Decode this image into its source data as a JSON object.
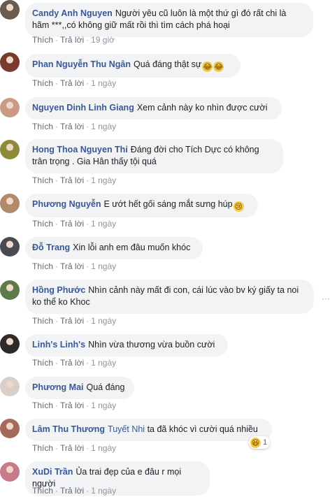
{
  "labels": {
    "like": "Thích",
    "reply": "Trả lời",
    "separator": "·"
  },
  "comments": [
    {
      "author": "Candy Anh Nguyen",
      "text": "Người yêu cũ luôn là một thứ gì đó rất chi là hãm ***,,có không giữ mất rồi thì tìm cách phá hoại",
      "time": "19 giờ"
    },
    {
      "author": "Phan Nguyễn Thu Ngân",
      "text": "Quá đáng thật sự",
      "emoji": [
        "😂",
        "😂"
      ],
      "time": "1 ngày"
    },
    {
      "author": "Nguyen Dinh Linh Giang",
      "text": "Xem cảnh này ko nhìn được cười",
      "time": "1 ngày"
    },
    {
      "author": "Hong Thoa Nguyen Thi",
      "text": "Đáng đời cho Tích Dực có không trân trọng . Gia Hân thấy tội quá",
      "time": "1 ngày"
    },
    {
      "author": "Phương Nguyễn",
      "text": "E ướt hết gối sáng mắt sưng húp",
      "emoji": [
        "😢"
      ],
      "time": "1 ngày"
    },
    {
      "author": "Đỗ Trang",
      "text": "Xin lỗi anh em đâu muốn khóc",
      "time": "1 ngày"
    },
    {
      "author": "Hồng Phước",
      "text": "Nhìn cảnh này mất đi con, cái lúc vào bv ký giấy ta noi ko thể ko Khoc",
      "time": "1 ngày"
    },
    {
      "author": "Linh's Linh's",
      "text": "Nhìn vừa thương vừa buồn cười",
      "time": "1 ngày"
    },
    {
      "author": "Phương Mai",
      "text": "Quá đáng",
      "time": "1 ngày"
    },
    {
      "author": "Lâm Thu Thương",
      "mention": "Tuyết Nhi",
      "text": "ta đã khóc vì cười quá nhiều",
      "reaction": {
        "emoji": "😆",
        "count": "1"
      },
      "time": "1 ngày"
    },
    {
      "author": "XuDi Trần",
      "text": "Ủa trai đẹp của e đâu r mọi người",
      "time": "1 ngày"
    }
  ],
  "avatar_colors": [
    "#6b5b4e",
    "#7a3a2e",
    "#c99a84",
    "#8d8a3a",
    "#b08a6a",
    "#4a4a52",
    "#5d7a4a",
    "#2e2a2a",
    "#d8cfc8",
    "#a56a5a",
    "#c77a8a"
  ]
}
